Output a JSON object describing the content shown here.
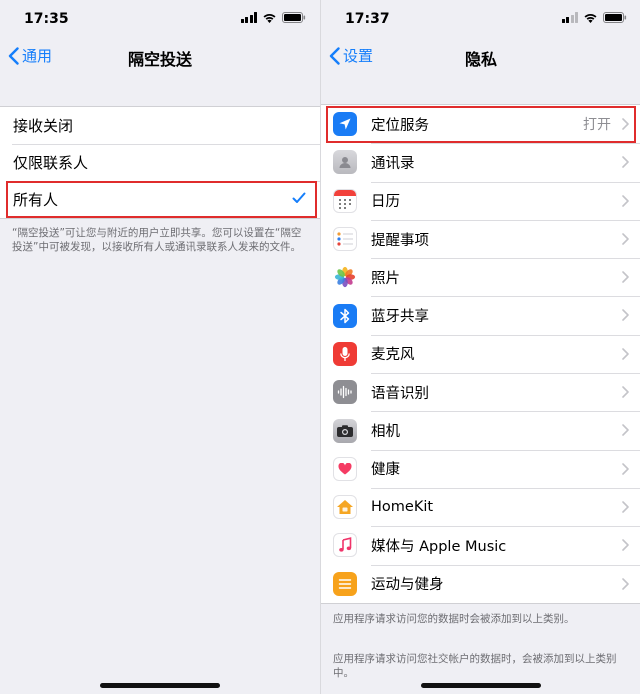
{
  "left": {
    "status": {
      "time": "17:35"
    },
    "nav": {
      "back_label": "通用",
      "title": "隔空投送"
    },
    "options": [
      {
        "label": "接收关闭"
      },
      {
        "label": "仅限联系人"
      },
      {
        "label": "所有人",
        "selected": true
      }
    ],
    "footnote": "“隔空投送”可让您与附近的用户立即共享。您可以设置在“隔空投送”中可被发现，以接收所有人或通讯录联系人发来的文件。"
  },
  "right": {
    "status": {
      "time": "17:37"
    },
    "nav": {
      "back_label": "设置",
      "title": "隐私"
    },
    "items": [
      {
        "label": "定位服务",
        "value": "打开",
        "icon": "location-arrow-icon"
      },
      {
        "label": "通讯录",
        "icon": "contacts-icon"
      },
      {
        "label": "日历",
        "icon": "calendar-icon"
      },
      {
        "label": "提醒事项",
        "icon": "reminders-icon"
      },
      {
        "label": "照片",
        "icon": "photos-icon"
      },
      {
        "label": "蓝牙共享",
        "icon": "bluetooth-icon"
      },
      {
        "label": "麦克风",
        "icon": "microphone-icon"
      },
      {
        "label": "语音识别",
        "icon": "speech-recognition-icon"
      },
      {
        "label": "相机",
        "icon": "camera-icon"
      },
      {
        "label": "健康",
        "icon": "health-icon"
      },
      {
        "label": "HomeKit",
        "icon": "homekit-icon"
      },
      {
        "label": "媒体与 Apple Music",
        "icon": "music-icon"
      },
      {
        "label": "运动与健身",
        "icon": "motion-fitness-icon"
      }
    ],
    "footnote1": "应用程序请求访问您的数据时会被添加到以上类别。",
    "footnote2": "应用程序请求访问您社交帐户的数据时，会被添加到以上类别中。"
  },
  "colors": {
    "accent": "#157efb",
    "highlight": "#e02c2c",
    "background": "#efeff4"
  }
}
